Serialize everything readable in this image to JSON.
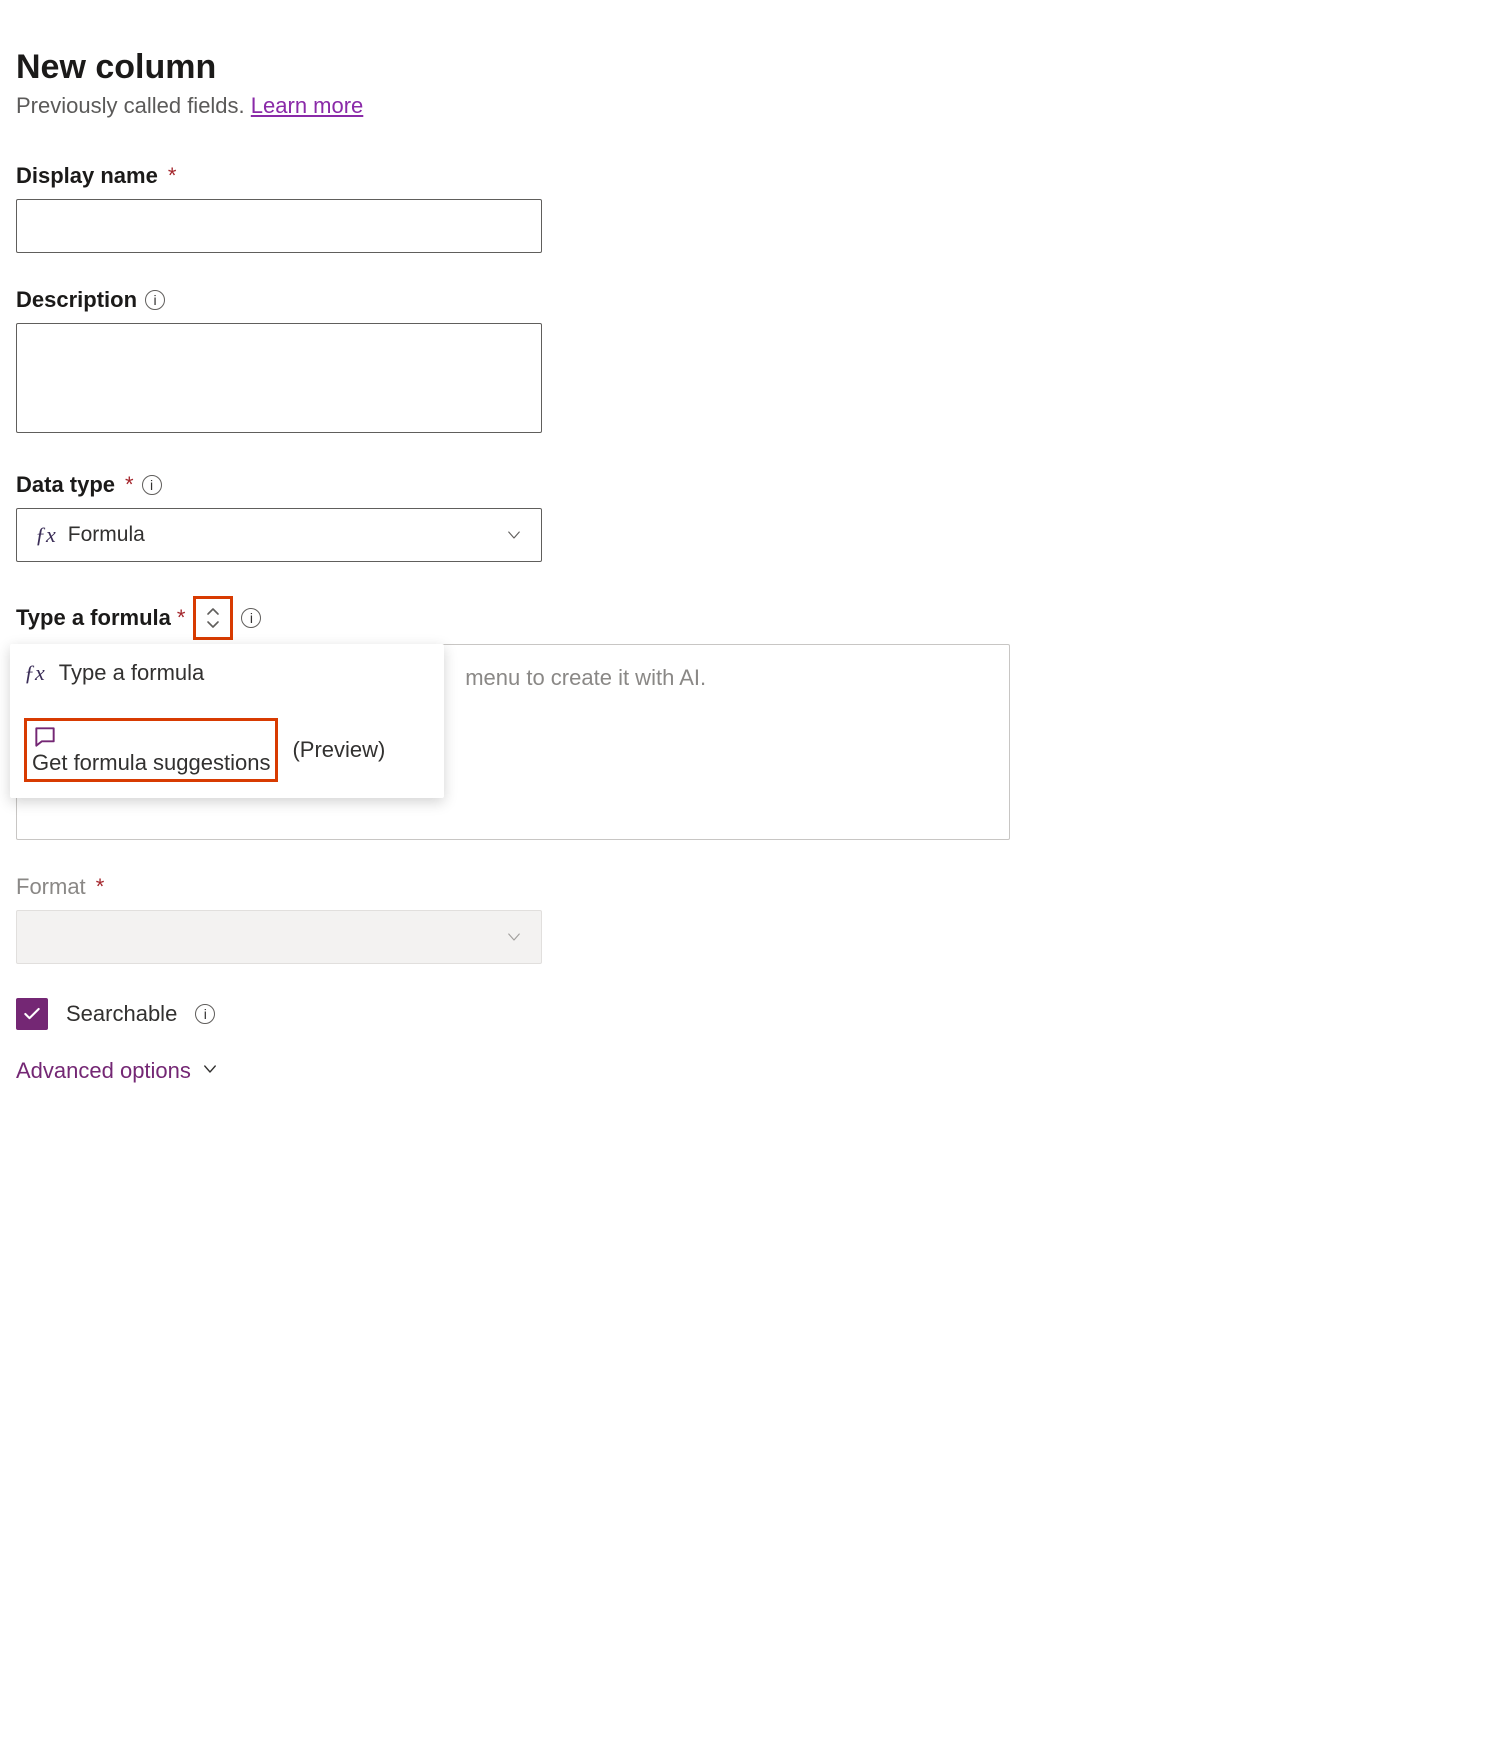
{
  "title": "New column",
  "subtitle_text": "Previously called fields. ",
  "learn_more": "Learn more",
  "display_name": {
    "label": "Display name",
    "value": ""
  },
  "description": {
    "label": "Description",
    "value": ""
  },
  "data_type": {
    "label": "Data type",
    "value": "Formula"
  },
  "formula": {
    "label": "Type a formula",
    "placeholder": "menu to create it with AI.",
    "menu": {
      "type_item": "Type a formula",
      "suggest_item": "Get formula suggestions",
      "preview_tag": "(Preview)"
    }
  },
  "format": {
    "label": "Format",
    "value": ""
  },
  "searchable": {
    "label": "Searchable",
    "checked": true
  },
  "advanced_options": "Advanced options",
  "required_marker": "*",
  "info_glyph": "i"
}
